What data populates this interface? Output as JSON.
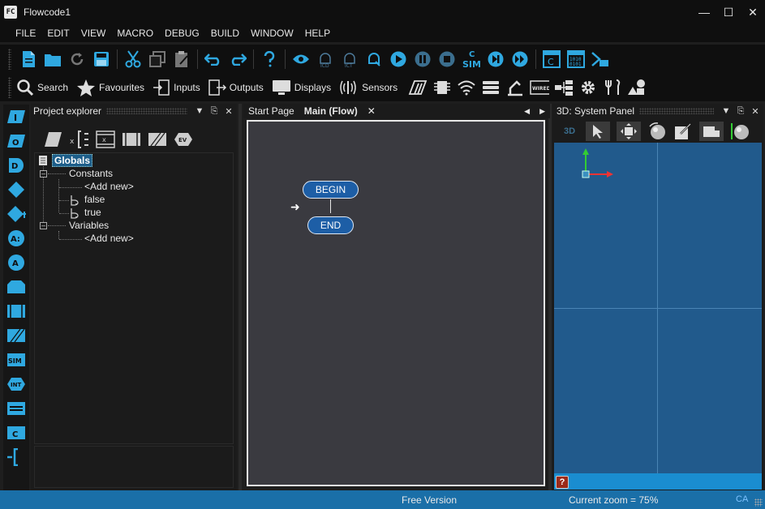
{
  "window": {
    "title": "Flowcode1",
    "logo_text": "FC"
  },
  "menu": [
    "FILE",
    "EDIT",
    "VIEW",
    "MACRO",
    "DEBUG",
    "BUILD",
    "WINDOW",
    "HELP"
  ],
  "toolbar2": {
    "search": "Search",
    "favourites": "Favourites",
    "inputs": "Inputs",
    "outputs": "Outputs",
    "displays": "Displays",
    "sensors": "Sensors"
  },
  "project_explorer": {
    "title": "Project explorer",
    "root": "Globals",
    "constants_label": "Constants",
    "constants": [
      "<Add new>",
      "false",
      "true"
    ],
    "variables_label": "Variables",
    "variables": [
      "<Add new>"
    ]
  },
  "document": {
    "tabs": [
      "Start Page",
      "Main (Flow)"
    ],
    "begin": "BEGIN",
    "end": "END"
  },
  "system_panel": {
    "title": "3D: System Panel",
    "label_3d": "3D"
  },
  "status": {
    "version": "Free Version",
    "zoom": "Current zoom = 75%",
    "caps": "CA"
  },
  "palette_labels": {
    "input": "I",
    "output": "O",
    "delay": "D",
    "calc1": "A:",
    "calc2": "A",
    "sim": "SIM",
    "int": "INT",
    "code": "C"
  },
  "proj_tool_labels": {
    "ev": "EV"
  },
  "toolbar1_labels": {
    "sim": "SIM",
    "c": "C"
  },
  "colors": {
    "accent": "#1a8dd0",
    "viewport": "#215a8c",
    "flow_terminal": "#1d5ea6",
    "statusbar": "#1a6fa8"
  }
}
